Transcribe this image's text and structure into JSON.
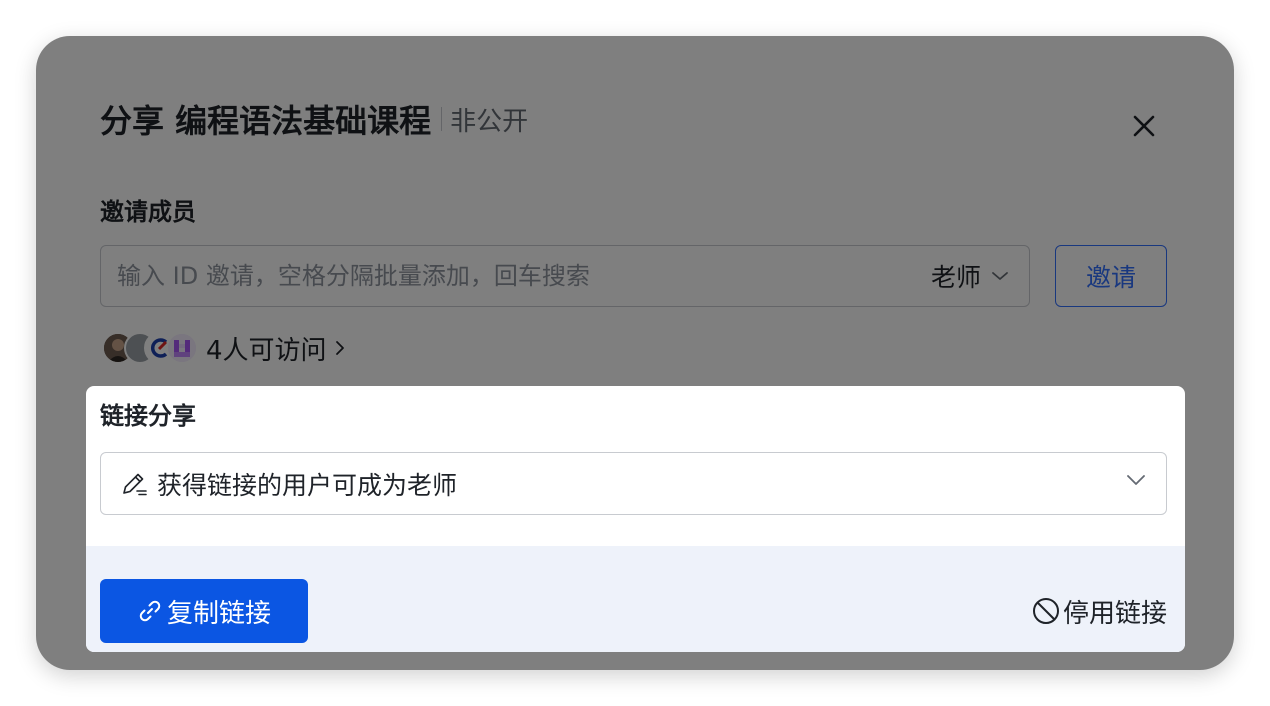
{
  "dialog": {
    "title": "分享 编程语法基础课程",
    "visibility": "非公开",
    "close_icon": "close-icon"
  },
  "invite": {
    "label": "邀请成员",
    "placeholder": "输入 ID 邀请，空格分隔批量添加，回车搜索",
    "value": "",
    "role": "老师",
    "button": "邀请"
  },
  "members": {
    "avatars": [
      "avatar-photo",
      "avatar-gray",
      "avatar-logo",
      "avatar-pixel"
    ],
    "count_text": "4人可访问"
  },
  "link_share": {
    "label": "链接分享",
    "permission": "获得链接的用户可成为老师",
    "copy_button": "复制链接",
    "disable_button": "停用链接"
  },
  "colors": {
    "primary": "#0b56e3",
    "accent_blue": "#3370ff",
    "footer_bg": "#eef2fa",
    "overlay": "rgba(0,0,0,0.5)"
  }
}
